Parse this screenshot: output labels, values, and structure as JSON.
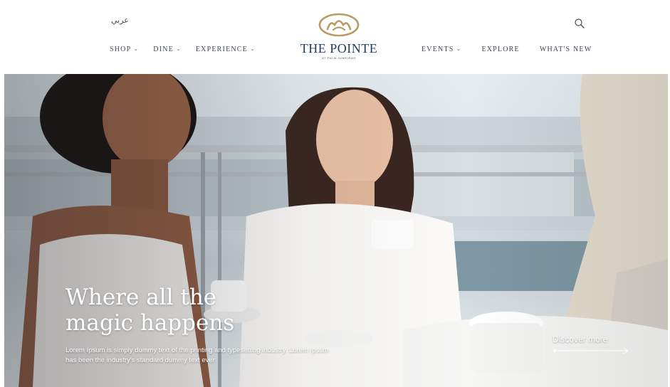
{
  "header": {
    "language_link": "عربي",
    "nav_left": [
      {
        "label": "SHOP",
        "has_dropdown": true
      },
      {
        "label": "DINE",
        "has_dropdown": true
      },
      {
        "label": "EXPERIENCE",
        "has_dropdown": true
      }
    ],
    "nav_right": [
      {
        "label": "EVENTS",
        "has_dropdown": true
      },
      {
        "label": "EXPLORE",
        "has_dropdown": false
      },
      {
        "label": "WHAT'S NEW",
        "has_dropdown": false
      }
    ],
    "logo": {
      "name": "THE POINTE",
      "tagline": "AT PALM JUMEIRAH",
      "icon": "crown-arches-logo-icon"
    },
    "search_icon": "search-icon"
  },
  "hero": {
    "title": "Where all the magic happens",
    "description": "Lorem Ipsum is simply dummy text of the printing and typesetting industry. Lorem Ipsum has been the industry's standard dummy text ever",
    "cta_label": "Discover more",
    "cta_icon": "arrow-right-icon"
  },
  "colors": {
    "brand_navy": "#1f3a5f",
    "logo_gold": "#b89b62",
    "nav_text": "#3c4654"
  }
}
